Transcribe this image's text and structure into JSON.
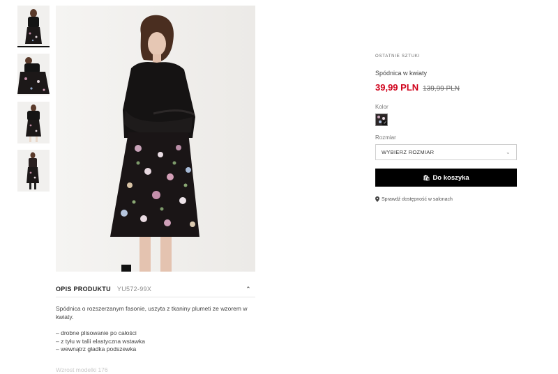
{
  "thumbnails": [
    {
      "name": "thumb-1",
      "active": true
    },
    {
      "name": "thumb-2",
      "active": false
    },
    {
      "name": "thumb-3",
      "active": false
    },
    {
      "name": "thumb-4",
      "active": false
    }
  ],
  "product": {
    "badge": "OSTATNIE SZTUKI",
    "name": "Spódnica w kwiaty",
    "price_now": "39,99 PLN",
    "price_old": "139,99 PLN",
    "color_label": "Kolor",
    "size_label": "Rozmiar",
    "size_placeholder": "WYBIERZ ROZMIAR",
    "cart_button": "Do koszyka",
    "check_stores": "Sprawdź dostępność w salonach"
  },
  "description": {
    "title": "OPIS PRODUKTU",
    "sku": "YU572-99X",
    "intro": "Spódnica o rozszerzanym fasonie, uszyta z tkaniny plumeti ze wzorem w kwiaty.",
    "bullets": [
      "– drobne plisowanie po całości",
      "– z tyłu w talii elastyczna wstawka",
      "– wewnątrz gładka podszewka"
    ],
    "more": "Wzrost modelki 176"
  },
  "colors": {
    "price_red": "#d0021b",
    "button_bg": "#000000"
  }
}
